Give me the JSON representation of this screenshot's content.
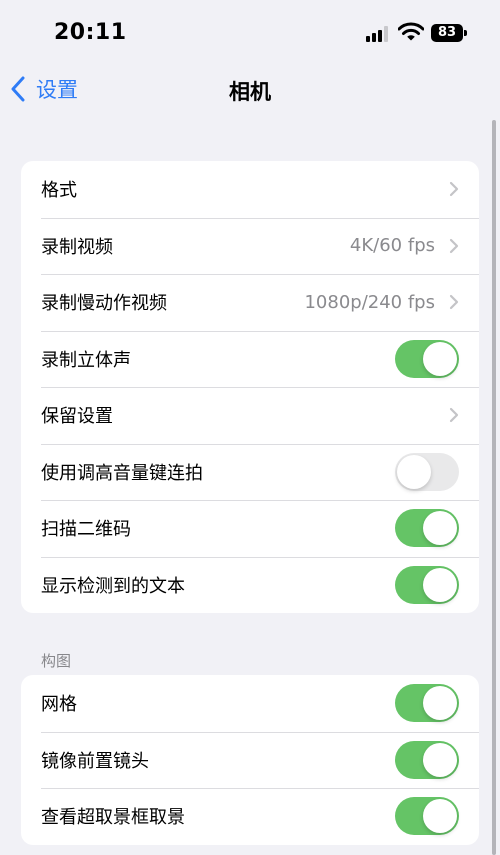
{
  "status_bar": {
    "time": "20:11",
    "battery": "83"
  },
  "nav": {
    "back_label": "设置",
    "title": "相机"
  },
  "group1": {
    "rows": [
      {
        "label": "格式",
        "value": "",
        "control": "chevron"
      },
      {
        "label": "录制视频",
        "value": "4K/60 fps",
        "control": "chevron"
      },
      {
        "label": "录制慢动作视频",
        "value": "1080p/240 fps",
        "control": "chevron"
      },
      {
        "label": "录制立体声",
        "value": "",
        "control": "toggle",
        "on": true
      },
      {
        "label": "保留设置",
        "value": "",
        "control": "chevron"
      },
      {
        "label": "使用调高音量键连拍",
        "value": "",
        "control": "toggle",
        "on": false
      },
      {
        "label": "扫描二维码",
        "value": "",
        "control": "toggle",
        "on": true
      },
      {
        "label": "显示检测到的文本",
        "value": "",
        "control": "toggle",
        "on": true
      }
    ]
  },
  "section2": {
    "header": "构图",
    "rows": [
      {
        "label": "网格",
        "control": "toggle",
        "on": true
      },
      {
        "label": "镜像前置镜头",
        "control": "toggle",
        "on": true
      },
      {
        "label": "查看超取景框取景",
        "control": "toggle",
        "on": true
      }
    ]
  },
  "colors": {
    "accent": "#2f7cf6",
    "toggle_on": "#65c466",
    "toggle_off": "#e9e9ea",
    "background": "#f1f1f6"
  }
}
